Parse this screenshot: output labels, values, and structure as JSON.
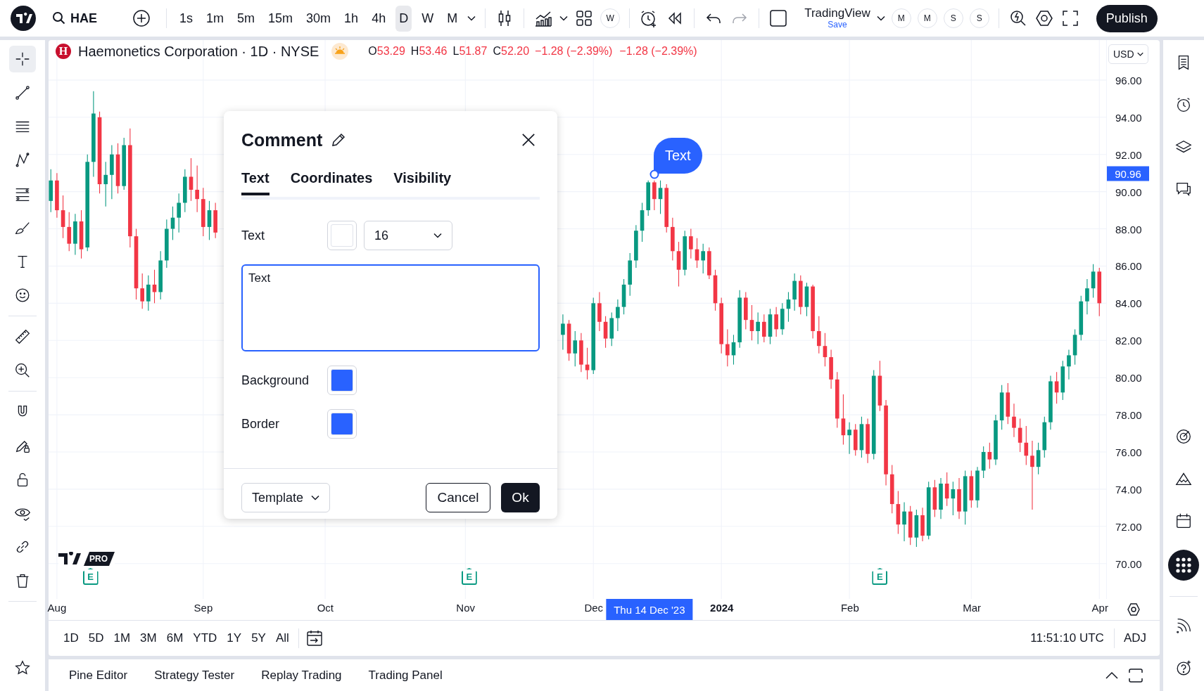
{
  "top_bar": {
    "symbol": "HAE",
    "intervals": [
      {
        "label": "1s",
        "selected": false
      },
      {
        "label": "1m",
        "selected": false
      },
      {
        "label": "5m",
        "selected": false
      },
      {
        "label": "15m",
        "selected": false
      },
      {
        "label": "30m",
        "selected": false
      },
      {
        "label": "1h",
        "selected": false
      },
      {
        "label": "4h",
        "selected": false
      },
      {
        "label": "D",
        "selected": true
      },
      {
        "label": "W",
        "selected": false
      },
      {
        "label": "M",
        "selected": false
      }
    ],
    "compare_button": "W",
    "layout_name": "TradingView",
    "layout_status": "Save",
    "flag_buttons": [
      "M",
      "M",
      "S",
      "S"
    ],
    "publish": "Publish"
  },
  "left_toolbar": {
    "tools": [
      {
        "selected": true
      },
      {
        "selected": false
      },
      {
        "selected": false
      },
      {
        "selected": false
      },
      {
        "selected": false
      },
      {
        "selected": false
      },
      {
        "selected": false
      },
      {
        "selected": false
      },
      {
        "selected": false
      },
      {
        "selected": false
      },
      {
        "selected": false
      },
      {
        "selected": false
      },
      {
        "selected": false
      },
      {
        "selected": false
      },
      {
        "selected": false
      },
      {
        "selected": false
      },
      {
        "selected": false
      }
    ]
  },
  "legend": {
    "symbol_logo": "H",
    "title": "Haemonetics Corporation · 1D · NYSE",
    "ohlc": [
      {
        "label": "O",
        "value": "53.29"
      },
      {
        "label": "H",
        "value": "53.46"
      },
      {
        "label": "L",
        "value": "51.87"
      },
      {
        "label": "C",
        "value": "52.20"
      }
    ],
    "changes": [
      "−1.28 (−2.39%)",
      "−1.28 (−2.39%)"
    ]
  },
  "currency": "USD",
  "chart": {
    "chart_data": {
      "type": "candlestick",
      "categories": [
        null,
        "Aug",
        null,
        null,
        null,
        null,
        null,
        null,
        null,
        null,
        null,
        null,
        null,
        null,
        null,
        null,
        null,
        null,
        null,
        null,
        null,
        null,
        null,
        null,
        null,
        "Sep",
        null,
        null,
        null,
        null,
        null,
        null,
        null,
        null,
        null,
        null,
        null,
        null,
        null,
        null,
        null,
        null,
        null,
        null,
        null,
        "Oct",
        null,
        null,
        null,
        null,
        null,
        null,
        null,
        null,
        null,
        null,
        null,
        null,
        null,
        null,
        null,
        null,
        null,
        null,
        null,
        null,
        null,
        null,
        "Nov",
        null,
        null,
        null,
        null,
        null,
        null,
        null,
        null,
        null,
        null,
        null,
        null,
        null,
        null,
        null,
        null,
        null,
        null,
        null,
        null,
        "Dec",
        null,
        null,
        null,
        null,
        null,
        null,
        null,
        null,
        null,
        null,
        null,
        null,
        null,
        null,
        null,
        null,
        null,
        null,
        null,
        null,
        "2024",
        null,
        null,
        null,
        null,
        null,
        null,
        null,
        null,
        null,
        null,
        null,
        null,
        null,
        null,
        null,
        null,
        null,
        null,
        null,
        null,
        "Feb",
        null,
        null,
        null,
        null,
        null,
        null,
        null,
        null,
        null,
        null,
        null,
        null,
        null,
        null,
        null,
        null,
        null,
        null,
        null,
        "Mar",
        null,
        null,
        null,
        null,
        null,
        null,
        null,
        null,
        null,
        null,
        null,
        null,
        null,
        null,
        null,
        null,
        null,
        null,
        null,
        null,
        "Apr"
      ],
      "ohlc": [
        [
          89.5,
          91.2,
          88.9,
          90.6
        ],
        [
          90.6,
          91.0,
          88.6,
          89.0
        ],
        [
          89.0,
          89.8,
          87.5,
          88.1
        ],
        [
          88.1,
          88.9,
          86.8,
          87.2
        ],
        [
          87.2,
          88.8,
          86.6,
          88.4
        ],
        [
          88.4,
          89.0,
          86.4,
          86.9
        ],
        [
          87.0,
          92.0,
          86.8,
          91.6
        ],
        [
          91.6,
          95.4,
          90.8,
          94.2
        ],
        [
          94.0,
          94.3,
          89.9,
          90.4
        ],
        [
          90.4,
          91.6,
          89.2,
          90.9
        ],
        [
          90.9,
          92.5,
          89.6,
          92.0
        ],
        [
          92.0,
          92.6,
          89.9,
          90.3
        ],
        [
          90.3,
          92.9,
          90.1,
          92.5
        ],
        [
          92.5,
          93.4,
          87.0,
          87.6
        ],
        [
          87.6,
          88.0,
          84.2,
          84.8
        ],
        [
          84.8,
          85.6,
          83.7,
          84.1
        ],
        [
          84.1,
          85.5,
          83.6,
          85.0
        ],
        [
          85.0,
          85.8,
          84.0,
          84.6
        ],
        [
          84.6,
          86.8,
          84.2,
          86.3
        ],
        [
          86.3,
          88.5,
          85.9,
          88.0
        ],
        [
          88.0,
          89.2,
          87.4,
          88.6
        ],
        [
          88.6,
          89.9,
          87.8,
          89.4
        ],
        [
          89.4,
          91.2,
          88.9,
          90.8
        ],
        [
          90.8,
          91.8,
          89.5,
          90.1
        ],
        [
          90.1,
          91.4,
          88.9,
          89.6
        ],
        [
          89.6,
          90.2,
          87.6,
          88.1
        ],
        [
          88.1,
          89.5,
          87.4,
          89.0
        ],
        [
          89.0,
          89.4,
          87.5,
          87.8
        ],
        null,
        null,
        null,
        null,
        null,
        null,
        null,
        null,
        null,
        null,
        null,
        null,
        null,
        null,
        null,
        null,
        null,
        null,
        null,
        null,
        null,
        null,
        null,
        null,
        null,
        null,
        null,
        null,
        null,
        null,
        null,
        null,
        null,
        null,
        null,
        null,
        null,
        null,
        null,
        null,
        null,
        null,
        null,
        null,
        null,
        null,
        null,
        null,
        null,
        null,
        null,
        null,
        null,
        null,
        null,
        null,
        [
          82.3,
          83.4,
          81.5,
          82.9
        ],
        [
          82.9,
          83.1,
          80.9,
          81.3
        ],
        [
          81.3,
          82.5,
          80.6,
          82.0
        ],
        [
          82.0,
          82.4,
          80.3,
          80.7
        ],
        [
          80.7,
          81.6,
          79.9,
          80.4
        ],
        [
          80.4,
          84.3,
          80.2,
          84.0
        ],
        [
          84.0,
          84.6,
          82.5,
          83.0
        ],
        [
          83.0,
          83.3,
          81.6,
          82.1
        ],
        [
          82.1,
          83.5,
          81.7,
          83.2
        ],
        [
          83.2,
          84.2,
          82.5,
          83.8
        ],
        [
          83.8,
          85.3,
          83.4,
          85.0
        ],
        [
          85.0,
          86.7,
          84.4,
          86.3
        ],
        [
          86.3,
          88.2,
          85.9,
          87.9
        ],
        [
          87.9,
          89.4,
          87.3,
          89.0
        ],
        [
          89.0,
          90.6,
          88.7,
          90.5
        ],
        [
          90.5,
          90.6,
          89.0,
          89.6
        ],
        [
          89.6,
          90.6,
          88.8,
          90.2
        ],
        [
          90.2,
          90.4,
          87.8,
          88.1
        ],
        [
          88.1,
          88.6,
          86.3,
          86.8
        ],
        [
          86.8,
          87.3,
          84.9,
          85.8
        ],
        [
          85.8,
          87.9,
          85.5,
          87.6
        ],
        [
          87.6,
          88.0,
          86.4,
          86.9
        ],
        [
          86.9,
          87.5,
          85.9,
          86.3
        ],
        [
          86.3,
          87.2,
          85.6,
          86.8
        ],
        [
          86.8,
          87.0,
          85.3,
          85.5
        ],
        [
          85.5,
          85.8,
          83.6,
          84.0
        ],
        [
          84.0,
          84.3,
          81.3,
          81.8
        ],
        [
          81.8,
          82.6,
          80.6,
          81.2
        ],
        [
          81.2,
          82.3,
          80.7,
          81.9
        ],
        [
          81.9,
          84.7,
          81.6,
          84.3
        ],
        [
          84.3,
          84.6,
          82.6,
          83.1
        ],
        [
          83.1,
          83.9,
          82.0,
          82.5
        ],
        [
          82.5,
          83.5,
          81.8,
          83.0
        ],
        [
          83.0,
          83.4,
          81.9,
          82.2
        ],
        [
          82.2,
          83.7,
          81.8,
          83.4
        ],
        [
          83.4,
          83.8,
          82.2,
          82.6
        ],
        [
          82.6,
          84.0,
          82.3,
          83.7
        ],
        [
          83.7,
          84.6,
          83.0,
          84.2
        ],
        [
          84.2,
          85.6,
          83.6,
          85.2
        ],
        [
          85.2,
          85.5,
          83.4,
          83.8
        ],
        [
          83.8,
          85.1,
          83.3,
          84.9
        ],
        [
          84.9,
          85.0,
          82.1,
          82.5
        ],
        [
          82.5,
          83.3,
          81.3,
          81.7
        ],
        [
          81.7,
          82.4,
          80.6,
          81.1
        ],
        [
          81.1,
          81.5,
          79.4,
          79.9
        ],
        [
          79.9,
          80.3,
          77.3,
          77.8
        ],
        [
          77.8,
          79.1,
          76.4,
          76.9
        ],
        [
          76.9,
          77.6,
          75.9,
          77.2
        ],
        [
          77.2,
          77.5,
          75.8,
          76.1
        ],
        [
          76.1,
          77.9,
          75.7,
          77.5
        ],
        [
          77.5,
          77.8,
          75.4,
          75.9
        ],
        [
          75.9,
          80.4,
          75.6,
          80.1
        ],
        [
          80.1,
          80.9,
          78.2,
          78.5
        ],
        [
          78.5,
          78.8,
          74.2,
          74.8
        ],
        [
          74.8,
          75.3,
          72.7,
          73.2
        ],
        [
          73.2,
          73.9,
          71.6,
          72.1
        ],
        [
          72.1,
          73.3,
          71.2,
          72.8
        ],
        [
          72.8,
          73.1,
          71.0,
          71.4
        ],
        [
          71.4,
          72.9,
          70.9,
          72.6
        ],
        [
          72.6,
          73.0,
          71.2,
          71.5
        ],
        [
          71.5,
          74.4,
          71.3,
          74.1
        ],
        [
          74.1,
          74.5,
          72.5,
          72.9
        ],
        [
          72.9,
          74.6,
          72.4,
          74.3
        ],
        [
          74.3,
          74.9,
          73.1,
          73.5
        ],
        [
          73.5,
          74.4,
          72.6,
          74.0
        ],
        [
          74.0,
          74.6,
          72.4,
          72.8
        ],
        [
          72.8,
          75.0,
          72.1,
          74.7
        ],
        [
          74.7,
          75.0,
          73.0,
          73.4
        ],
        [
          73.4,
          75.2,
          73.0,
          75.0
        ],
        [
          75.0,
          76.3,
          74.6,
          76.0
        ],
        [
          76.0,
          76.5,
          75.1,
          75.6
        ],
        [
          75.6,
          78.0,
          75.3,
          77.7
        ],
        [
          77.7,
          79.6,
          77.2,
          79.2
        ],
        [
          79.2,
          79.7,
          77.5,
          77.9
        ],
        [
          77.9,
          78.6,
          76.8,
          77.3
        ],
        [
          77.3,
          77.8,
          76.0,
          76.5
        ],
        [
          76.5,
          77.4,
          75.3,
          75.8
        ],
        [
          75.8,
          76.6,
          72.9,
          75.2
        ],
        [
          75.2,
          76.5,
          74.8,
          76.1
        ],
        [
          76.1,
          77.9,
          75.7,
          77.6
        ],
        [
          77.6,
          80.1,
          77.2,
          79.8
        ],
        [
          79.8,
          80.3,
          78.6,
          79.2
        ],
        [
          79.2,
          80.9,
          78.8,
          80.6
        ],
        [
          80.6,
          81.5,
          79.9,
          81.2
        ],
        [
          81.2,
          82.6,
          80.7,
          82.3
        ],
        [
          82.3,
          84.4,
          82.0,
          84.1
        ],
        [
          84.1,
          85.3,
          83.4,
          84.8
        ],
        [
          84.8,
          86.1,
          84.3,
          85.7
        ],
        [
          85.7,
          85.9,
          83.3,
          84.0
        ]
      ],
      "ylim": [
        68.1,
        98.15
      ],
      "grid": true,
      "yticks": [
        {
          "value": 96,
          "label": "96.00"
        },
        {
          "value": 94,
          "label": "94.00"
        },
        {
          "value": 92,
          "label": "92.00"
        },
        {
          "value": 90,
          "label": "90.00"
        },
        {
          "value": 88,
          "label": "88.00"
        },
        {
          "value": 86,
          "label": "86.00"
        },
        {
          "value": 84,
          "label": "84.00"
        },
        {
          "value": 82,
          "label": "82.00"
        },
        {
          "value": 80,
          "label": "80.00"
        },
        {
          "value": 78,
          "label": "78.00"
        },
        {
          "value": 76,
          "label": "76.00"
        },
        {
          "value": 74,
          "label": "74.00"
        },
        {
          "value": 72,
          "label": "72.00"
        },
        {
          "value": 70,
          "label": "70.00"
        }
      ]
    },
    "last_price": "90.96"
  },
  "time_axis": {
    "crosshair_date": "Thu 14 Dec '23"
  },
  "earnings_markers": [
    "E",
    "E",
    "E"
  ],
  "pro_badge": "PRO",
  "comment_bubble": {
    "text": "Text"
  },
  "dialog": {
    "title": "Comment",
    "tabs": [
      {
        "label": "Text",
        "selected": true
      },
      {
        "label": "Coordinates",
        "selected": false
      },
      {
        "label": "Visibility",
        "selected": false
      }
    ],
    "text_row": {
      "label": "Text",
      "color": "#ffffff",
      "size": "16"
    },
    "text_value": "Text",
    "color_rows": [
      {
        "label": "Background",
        "color": "#2962ff"
      },
      {
        "label": "Border",
        "color": "#2962ff"
      }
    ],
    "template": "Template",
    "cancel": "Cancel",
    "ok": "Ok"
  },
  "range_bar": {
    "ranges": [
      "1D",
      "5D",
      "1M",
      "3M",
      "6M",
      "YTD",
      "1Y",
      "5Y",
      "All"
    ],
    "time": "11:51:10 UTC",
    "adjust": "ADJ"
  },
  "bottom_panel": {
    "tabs": [
      "Pine Editor",
      "Strategy Tester",
      "Replay Trading",
      "Trading Panel"
    ]
  }
}
